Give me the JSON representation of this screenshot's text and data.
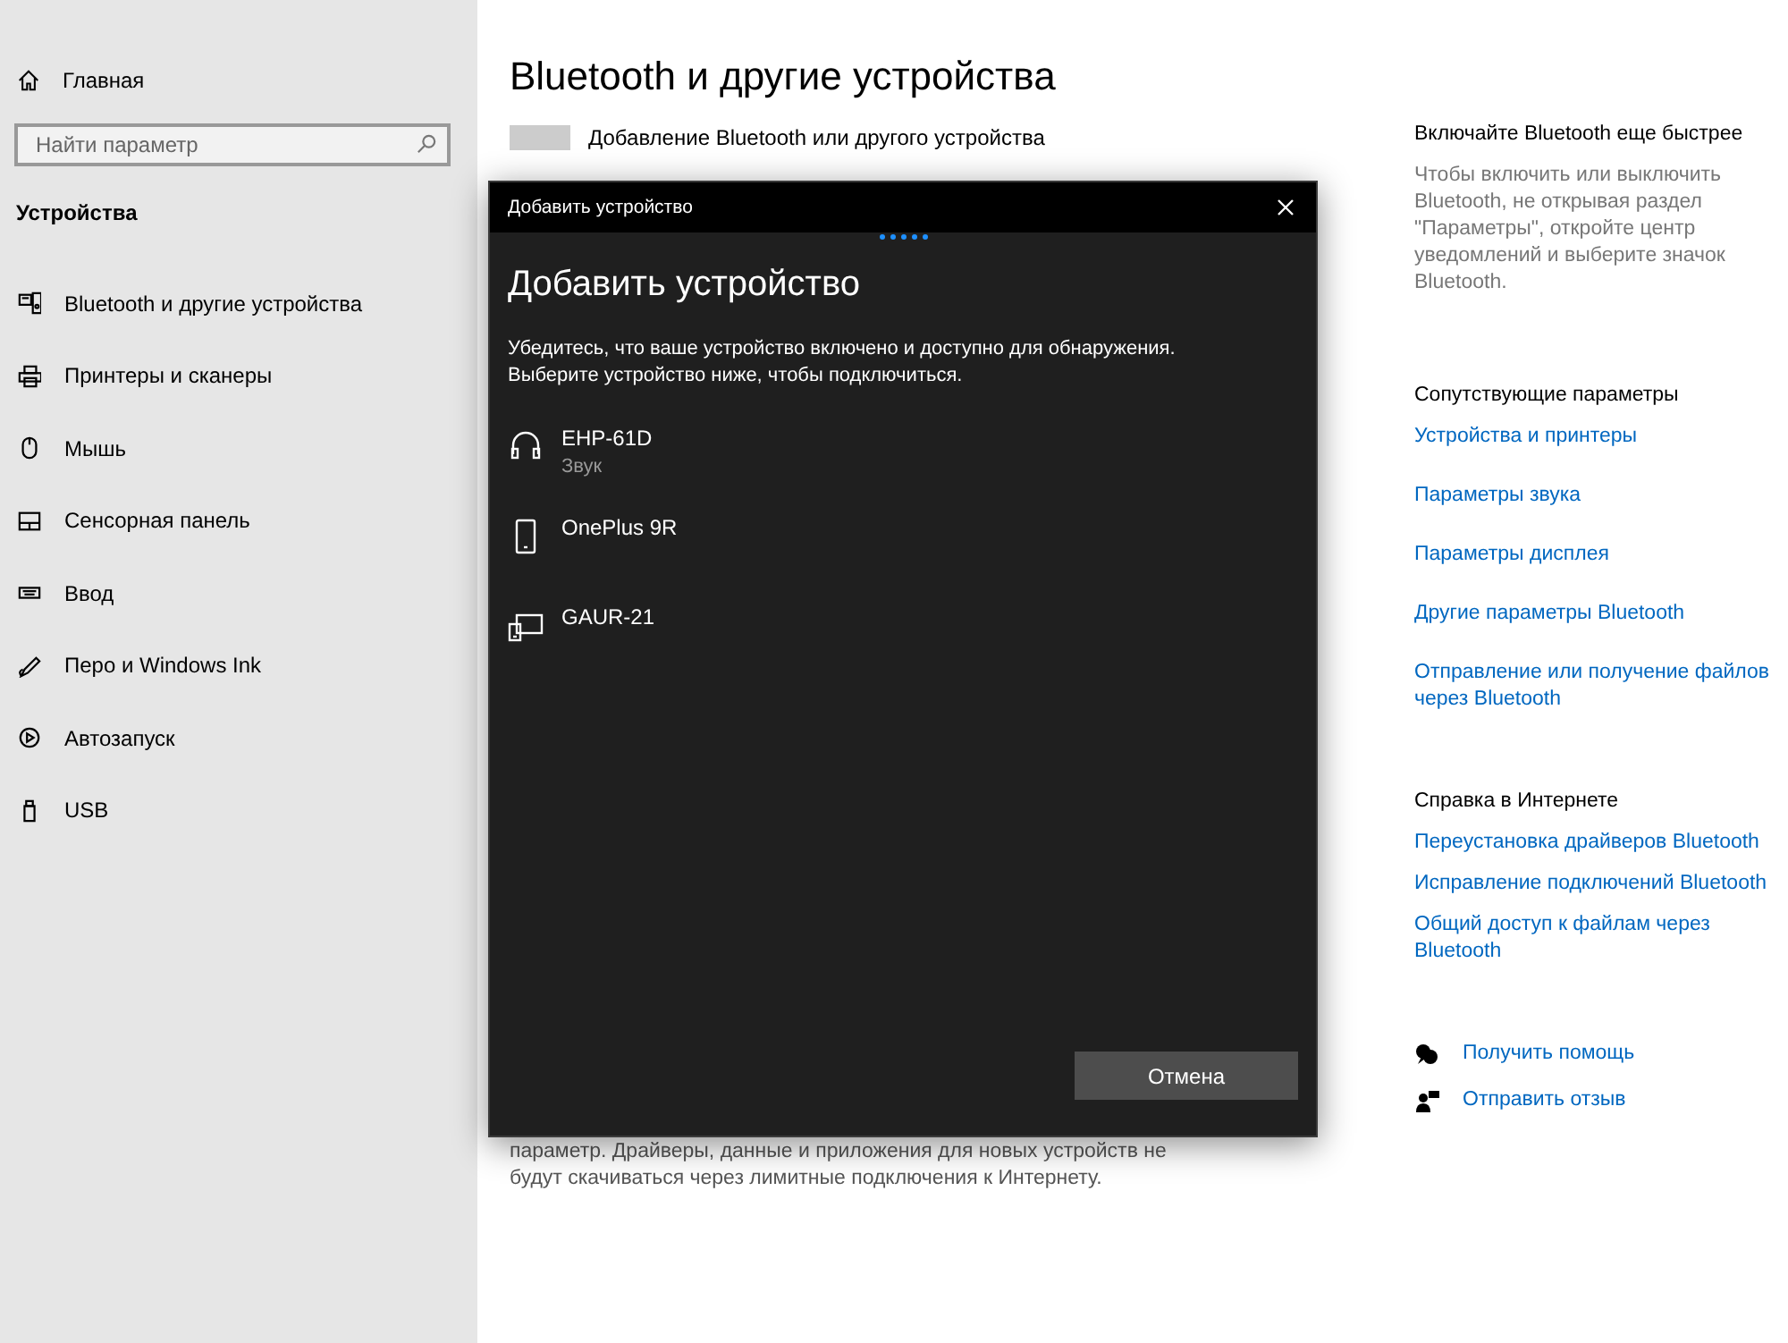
{
  "sidebar": {
    "home": "Главная",
    "search": {
      "placeholder": "Найти параметр"
    },
    "section": "Устройства",
    "items": [
      {
        "label": "Bluetooth и другие устройства",
        "kind": "bluetooth"
      },
      {
        "label": "Принтеры и сканеры",
        "kind": "printer"
      },
      {
        "label": "Мышь",
        "kind": "mouse"
      },
      {
        "label": "Сенсорная панель",
        "kind": "touchpad"
      },
      {
        "label": "Ввод",
        "kind": "keyboard"
      },
      {
        "label": "Перо и Windows Ink",
        "kind": "pen"
      },
      {
        "label": "Автозапуск",
        "kind": "autoplay"
      },
      {
        "label": "USB",
        "kind": "usb"
      }
    ]
  },
  "main": {
    "title": "Bluetooth и другие устройства",
    "add_button": "Добавление Bluetooth или другого устройства",
    "note": "параметр. Драйверы, данные и приложения для новых устройств не будут скачиваться через лимитные подключения к Интернету."
  },
  "dialog": {
    "title": "Добавить устройство",
    "heading": "Добавить устройство",
    "description": [
      "Убедитесь, что ваше устройство включено и доступно для обнаружения.",
      "Выберите устройство ниже, чтобы подключиться."
    ],
    "devices": [
      {
        "name": "EHP-61D",
        "type": "Звук",
        "kind": "headphones"
      },
      {
        "name": "OnePlus 9R",
        "kind": "phone"
      },
      {
        "name": "GAUR-21",
        "kind": "computer"
      }
    ],
    "cancel": "Отмена"
  },
  "side_panel": {
    "quick": {
      "title": "Включайте Bluetooth еще быстрее",
      "text": "Чтобы включить или выключить Bluetooth, не открывая раздел \"Параметры\", откройте центр уведомлений и выберите значок Bluetooth."
    },
    "related": {
      "title": "Сопутствующие параметры",
      "links": [
        "Устройства и принтеры",
        "Параметры звука",
        "Параметры дисплея",
        "Другие параметры Bluetooth",
        "Отправление или получение файлов через Bluetooth"
      ]
    },
    "help": {
      "title": "Справка в Интернете",
      "links": [
        "Переустановка драйверов Bluetooth",
        "Исправление подключений Bluetooth",
        "Общий доступ к файлам через Bluetooth"
      ]
    },
    "actions": [
      {
        "label": "Получить помощь",
        "kind": "help"
      },
      {
        "label": "Отправить отзыв",
        "kind": "feedback"
      }
    ]
  }
}
